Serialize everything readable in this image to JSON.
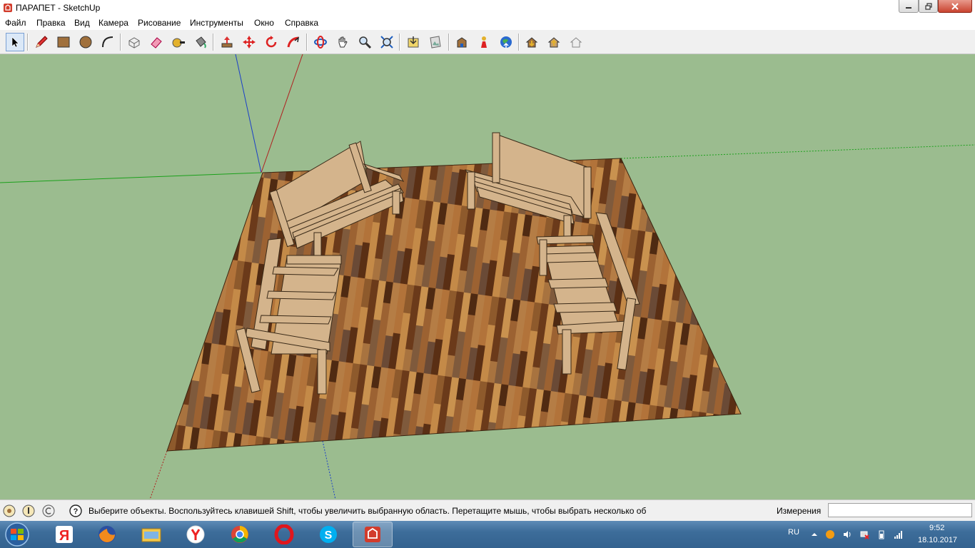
{
  "window": {
    "title": "ПАРАПЕТ - SketchUp",
    "app_icon": "sketchup-icon"
  },
  "menu": {
    "items": [
      "Файл",
      "Правка",
      "Вид",
      "Камера",
      "Рисование",
      "Инструменты",
      "Окно",
      "Справка"
    ]
  },
  "toolbar": {
    "tools": [
      "select-tool-icon",
      "pencil-tool-icon",
      "rectangle-tool-icon",
      "circle-tool-icon",
      "arc-tool-icon",
      "make-component-icon",
      "eraser-tool-icon",
      "tape-measure-icon",
      "paint-bucket-icon",
      "push-pull-icon",
      "move-tool-icon",
      "rotate-tool-icon",
      "follow-me-icon",
      "orbit-tool-icon",
      "pan-tool-icon",
      "zoom-tool-icon",
      "zoom-extents-icon",
      "add-location-icon",
      "photo-textures-icon",
      "get-models-icon",
      "extension-warehouse-icon",
      "earth-icon",
      "share-model-icon",
      "share-component-icon",
      "3d-text-icon"
    ],
    "active_tool": "select-tool-icon"
  },
  "status": {
    "hint": "Выберите объекты. Воспользуйтесь клавишей Shift, чтобы увеличить выбранную область. Перетащите мышь, чтобы выбрать несколько об",
    "measurements_label": "Измерения",
    "measurements_value": ""
  },
  "taskbar": {
    "apps": [
      "yandex-icon",
      "firefox-icon",
      "file-explorer-icon",
      "yandex-browser-icon",
      "chrome-icon",
      "opera-icon",
      "skype-icon",
      "sketchup-icon"
    ],
    "active_app": "sketchup-icon",
    "language": "RU",
    "time": "9:52",
    "date": "18.10.2017"
  },
  "colors": {
    "sky_ground": "#9bbc8f",
    "floor_dark": "#6e3d1c",
    "floor_light": "#b87a3c",
    "bench_wood": "#d4b48c",
    "taskbar": "#3d6d9a"
  }
}
